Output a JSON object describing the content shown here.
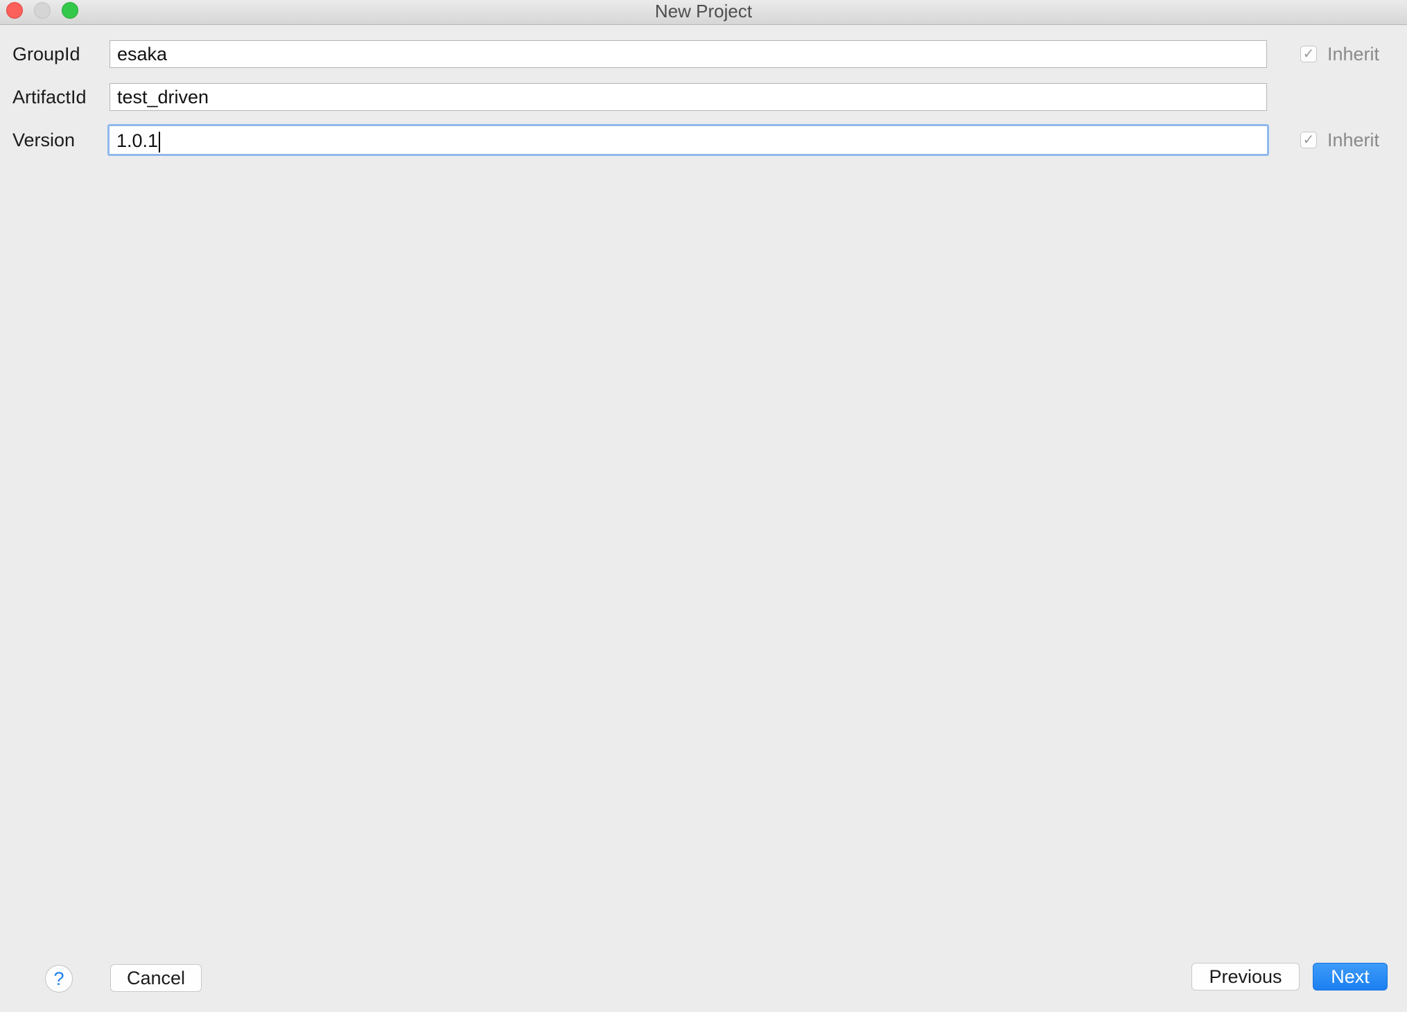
{
  "window": {
    "title": "New Project"
  },
  "form": {
    "group_id": {
      "label": "GroupId",
      "value": "esaka",
      "inherit_label": "Inherit",
      "inherit_checked": true
    },
    "artifact_id": {
      "label": "ArtifactId",
      "value": "test_driven"
    },
    "version": {
      "label": "Version",
      "value": "1.0.1",
      "inherit_label": "Inherit",
      "inherit_checked": true
    }
  },
  "footer": {
    "help_glyph": "?",
    "cancel_label": "Cancel",
    "previous_label": "Previous",
    "next_label": "Next"
  },
  "icons": {
    "check": "✓"
  },
  "colors": {
    "accent": "#1b7ff0",
    "focus_ring": "#8fb8ed",
    "close": "#fc605b",
    "zoom": "#34c84a"
  }
}
